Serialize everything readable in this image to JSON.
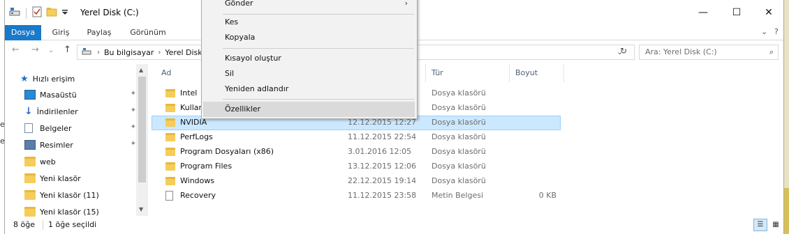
{
  "background": {
    "left_text": [
      "e",
      "e"
    ]
  },
  "window": {
    "title": "Yerel Disk (C:)",
    "controls": {
      "minimize": "—",
      "maximize": "☐",
      "close": "✕"
    }
  },
  "ribbon": {
    "tabs": [
      {
        "label": "Dosya",
        "active": true
      },
      {
        "label": "Giriş",
        "active": false
      },
      {
        "label": "Paylaş",
        "active": false
      },
      {
        "label": "Görünüm",
        "active": false
      }
    ],
    "collapse_glyph": "⌄",
    "help_glyph": "?"
  },
  "nav": {
    "back": "←",
    "forward": "→",
    "recent": "⌄",
    "up": "↑",
    "breadcrumb": [
      "Bu bilgisayar",
      "Yerel Disk"
    ],
    "search_placeholder": "Ara: Yerel Disk (C:)"
  },
  "sidebar": {
    "items": [
      {
        "label": "Hızlı erişim",
        "icon": "star-icon",
        "pinned": false
      },
      {
        "label": "Masaüstü",
        "icon": "desktop-icon",
        "pinned": true
      },
      {
        "label": "İndirilenler",
        "icon": "download-icon",
        "pinned": true
      },
      {
        "label": "Belgeler",
        "icon": "documents-icon",
        "pinned": true
      },
      {
        "label": "Resimler",
        "icon": "pictures-icon",
        "pinned": true
      },
      {
        "label": "web",
        "icon": "folder-icon",
        "pinned": false
      },
      {
        "label": "Yeni klasör",
        "icon": "folder-icon",
        "pinned": false
      },
      {
        "label": "Yeni klasör (11)",
        "icon": "folder-icon",
        "pinned": false
      },
      {
        "label": "Yeni klasör (15)",
        "icon": "folder-icon",
        "pinned": false
      }
    ]
  },
  "columns": {
    "name": "Ad",
    "date": "",
    "type": "Tür",
    "size": "Boyut"
  },
  "files": [
    {
      "name": "Intel",
      "date": "",
      "type": "Dosya klasörü",
      "size": "",
      "kind": "folder",
      "selected": false
    },
    {
      "name": "Kullanı",
      "date": "",
      "type": "Dosya klasörü",
      "size": "",
      "kind": "folder",
      "selected": false
    },
    {
      "name": "NVIDIA",
      "date": "12.12.2015 12:27",
      "type": "Dosya klasörü",
      "size": "",
      "kind": "folder",
      "selected": true
    },
    {
      "name": "PerfLogs",
      "date": "11.12.2015 22:54",
      "type": "Dosya klasörü",
      "size": "",
      "kind": "folder",
      "selected": false
    },
    {
      "name": "Program Dosyaları (x86)",
      "date": "3.01.2016 12:05",
      "type": "Dosya klasörü",
      "size": "",
      "kind": "folder",
      "selected": false
    },
    {
      "name": "Program Files",
      "date": "13.12.2015 12:06",
      "type": "Dosya klasörü",
      "size": "",
      "kind": "folder",
      "selected": false
    },
    {
      "name": "Windows",
      "date": "22.12.2015 19:14",
      "type": "Dosya klasörü",
      "size": "",
      "kind": "folder",
      "selected": false
    },
    {
      "name": "Recovery",
      "date": "11.12.2015 23:58",
      "type": "Metin Belgesi",
      "size": "0 KB",
      "kind": "file",
      "selected": false
    }
  ],
  "status": {
    "item_count": "8 öğe",
    "selected_count": "1 öğe seçildi"
  },
  "context_menu": {
    "items": [
      {
        "label": "Gönder",
        "submenu": true,
        "hover": false
      },
      {
        "label": "Kes",
        "submenu": false,
        "hover": false
      },
      {
        "label": "Kopyala",
        "submenu": false,
        "hover": false
      },
      {
        "label": "Kısayol oluştur",
        "submenu": false,
        "hover": false
      },
      {
        "label": "Sil",
        "submenu": false,
        "hover": false
      },
      {
        "label": "Yeniden adlandır",
        "submenu": false,
        "hover": false
      },
      {
        "label": "Özellikler",
        "submenu": false,
        "hover": true
      }
    ],
    "submenu_glyph": "›"
  },
  "colors": {
    "accent": "#1979ca",
    "selection": "#cce8ff",
    "selection_border": "#99d1ff",
    "folder": "#f4cd5a",
    "menu_bg": "#f2f2f2",
    "menu_hover": "#dadada"
  }
}
